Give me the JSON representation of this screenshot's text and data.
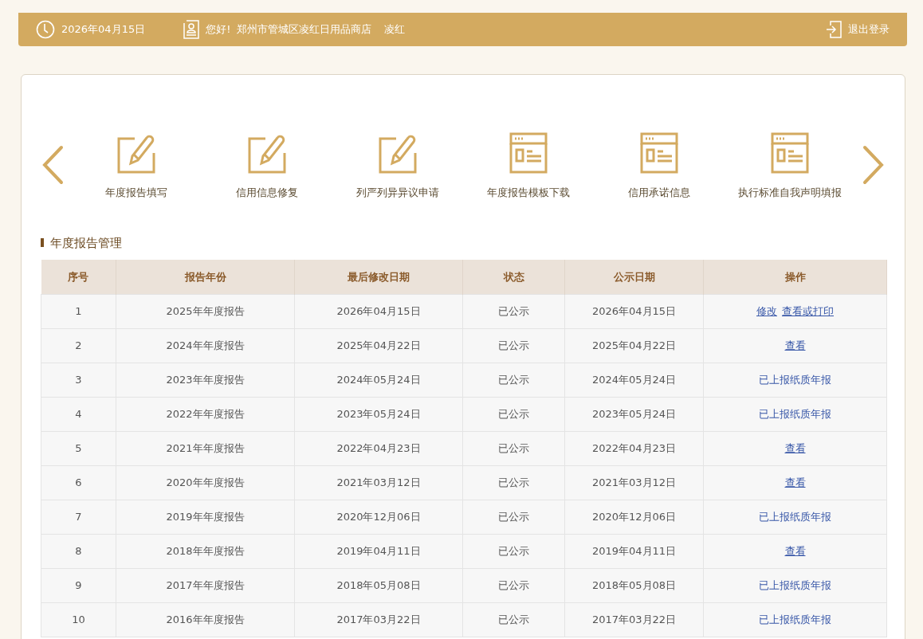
{
  "header": {
    "date": "2026年04月15日",
    "greeting": "您好!",
    "company": "郑州市管城区凌红日用品商店",
    "user": "凌红",
    "logout": "退出登录"
  },
  "shortcuts": [
    {
      "kind": "edit",
      "label": "年度报告填写"
    },
    {
      "kind": "edit",
      "label": "信用信息修复"
    },
    {
      "kind": "edit",
      "label": "列严列异异议申请"
    },
    {
      "kind": "form",
      "label": "年度报告模板下载"
    },
    {
      "kind": "form",
      "label": "信用承诺信息"
    },
    {
      "kind": "form",
      "label": "执行标准自我声明填报"
    }
  ],
  "section_title": "年度报告管理",
  "table": {
    "columns": [
      "序号",
      "报告年份",
      "最后修改日期",
      "状态",
      "公示日期",
      "操作"
    ],
    "rows": [
      {
        "cells": [
          "1",
          "2025年年度报告",
          "2026年04月15日",
          "已公示",
          "2026年04月15日"
        ],
        "actions": [
          {
            "kind": "link",
            "text": "修改"
          },
          {
            "kind": "link",
            "text": "查看或打印"
          }
        ]
      },
      {
        "cells": [
          "2",
          "2024年年度报告",
          "2025年04月22日",
          "已公示",
          "2025年04月22日"
        ],
        "actions": [
          {
            "kind": "link",
            "text": "查看"
          }
        ]
      },
      {
        "cells": [
          "3",
          "2023年年度报告",
          "2024年05月24日",
          "已公示",
          "2024年05月24日"
        ],
        "actions": [
          {
            "kind": "text",
            "text": "已上报纸质年报"
          }
        ]
      },
      {
        "cells": [
          "4",
          "2022年年度报告",
          "2023年05月24日",
          "已公示",
          "2023年05月24日"
        ],
        "actions": [
          {
            "kind": "text",
            "text": "已上报纸质年报"
          }
        ]
      },
      {
        "cells": [
          "5",
          "2021年年度报告",
          "2022年04月23日",
          "已公示",
          "2022年04月23日"
        ],
        "actions": [
          {
            "kind": "link",
            "text": "查看"
          }
        ]
      },
      {
        "cells": [
          "6",
          "2020年年度报告",
          "2021年03月12日",
          "已公示",
          "2021年03月12日"
        ],
        "actions": [
          {
            "kind": "link",
            "text": "查看"
          }
        ]
      },
      {
        "cells": [
          "7",
          "2019年年度报告",
          "2020年12月06日",
          "已公示",
          "2020年12月06日"
        ],
        "actions": [
          {
            "kind": "text",
            "text": "已上报纸质年报"
          }
        ]
      },
      {
        "cells": [
          "8",
          "2018年年度报告",
          "2019年04月11日",
          "已公示",
          "2019年04月11日"
        ],
        "actions": [
          {
            "kind": "link",
            "text": "查看"
          }
        ]
      },
      {
        "cells": [
          "9",
          "2017年年度报告",
          "2018年05月08日",
          "已公示",
          "2018年05月08日"
        ],
        "actions": [
          {
            "kind": "text",
            "text": "已上报纸质年报"
          }
        ]
      },
      {
        "cells": [
          "10",
          "2016年年度报告",
          "2017年03月22日",
          "已公示",
          "2017年03月22日"
        ],
        "actions": [
          {
            "kind": "text",
            "text": "已上报纸质年报"
          }
        ]
      }
    ]
  }
}
